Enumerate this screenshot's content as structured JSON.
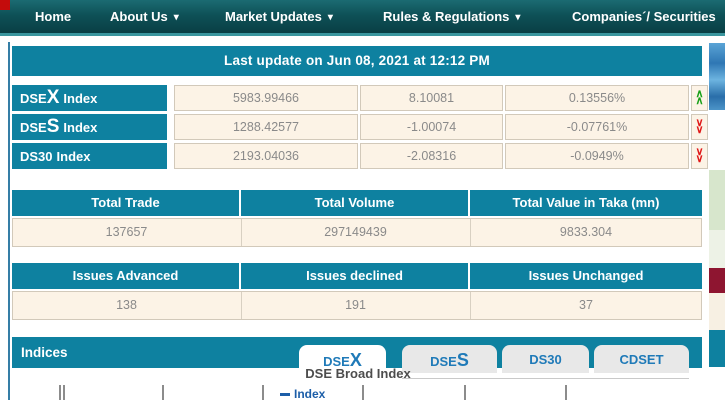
{
  "nav": {
    "items": [
      {
        "label": "Home",
        "dropdown": false
      },
      {
        "label": "About Us",
        "dropdown": true
      },
      {
        "label": "Market Updates",
        "dropdown": true
      },
      {
        "label": "Rules & Regulations",
        "dropdown": true
      },
      {
        "label": "Companies´/ Securities",
        "dropdown": false
      }
    ]
  },
  "icons": {
    "caret_down": "▾",
    "chevron_up": "∧",
    "chevron_down": "∨"
  },
  "last_update": {
    "text": "Last update on Jun 08, 2021 at 12:12 PM"
  },
  "index_table": {
    "rows": [
      {
        "label_pre": "DSE",
        "label_big": "X",
        "label_post": "Index",
        "value": "5983.99466",
        "change": "8.10081",
        "change_pct": "0.13556%",
        "direction": "up",
        "arrow_class": "arrow up",
        "glyph": "∧"
      },
      {
        "label_pre": "DSE",
        "label_big": "S",
        "label_post": "Index",
        "value": "1288.42577",
        "change": "-1.00074",
        "change_pct": "-0.07761%",
        "direction": "down",
        "arrow_class": "arrow down",
        "glyph": "∨"
      },
      {
        "label_pre": "DS30",
        "label_big": "",
        "label_post": "Index",
        "value": "2193.04036",
        "change": "-2.08316",
        "change_pct": "-0.0949%",
        "direction": "down",
        "arrow_class": "arrow down",
        "glyph": "∨"
      }
    ]
  },
  "totals": {
    "headers": [
      "Total Trade",
      "Total Volume",
      "Total Value in Taka (mn)"
    ],
    "values": [
      "137657",
      "297149439",
      "9833.304"
    ]
  },
  "issues": {
    "headers": [
      "Issues Advanced",
      "Issues declined",
      "Issues Unchanged"
    ],
    "values": [
      "138",
      "191",
      "37"
    ]
  },
  "indices_panel": {
    "title": "Indices",
    "tabs": [
      {
        "pre": "DSE",
        "big": "X",
        "active": true
      },
      {
        "pre": "DSE",
        "big": "S",
        "active": false
      },
      {
        "pre": "DS30",
        "big": "",
        "active": false
      },
      {
        "pre": "CDSET",
        "big": "",
        "active": false
      }
    ],
    "chart": {
      "title": "DSE Broad Index",
      "legend_label": "Index"
    }
  },
  "colors": {
    "teal_primary": "#0e81a0",
    "nav_dark": "#0e5157",
    "cream_cell": "#fcf3e6",
    "cell_border": "#d2c9ba",
    "cell_text": "#8a8a8a",
    "up_green": "#18a018",
    "down_red": "#e01717",
    "tab_blue": "#1f7ab8",
    "legend_blue": "#1c5ea8",
    "red_square": "#c40c0c",
    "sidebar_red": "#8e1530",
    "sidebar_green": "#d7e6cc"
  }
}
